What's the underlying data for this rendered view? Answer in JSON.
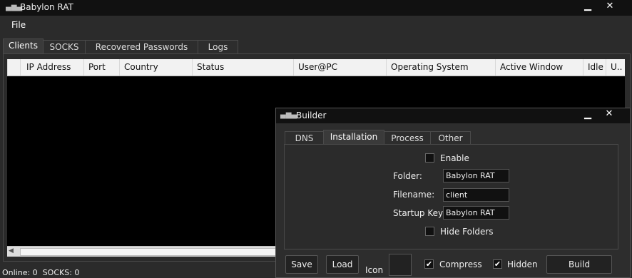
{
  "window": {
    "title": "Babylon RAT",
    "minimize_label": "▁",
    "close_label": "✕"
  },
  "menu": {
    "file_label": "File"
  },
  "tabs": [
    {
      "label": "Clients",
      "active": true
    },
    {
      "label": "SOCKS",
      "active": false
    },
    {
      "label": "Recovered Passwords",
      "active": false
    },
    {
      "label": "Logs",
      "active": false
    }
  ],
  "table": {
    "columns": [
      "IP Address",
      "Port",
      "Country",
      "Status",
      "User@PC",
      "Operating System",
      "Active Window",
      "Idle",
      "U.."
    ],
    "rows": []
  },
  "status": {
    "text": "Online: 0  SOCKS: 0"
  },
  "builder": {
    "title": "Builder",
    "minimize_label": "▁",
    "close_label": "✕",
    "tabs": [
      {
        "label": "DNS",
        "active": false
      },
      {
        "label": "Installation",
        "active": true
      },
      {
        "label": "Process",
        "active": false
      },
      {
        "label": "Other",
        "active": false
      }
    ],
    "installation": {
      "enable_label": "Enable",
      "enable_checked": false,
      "folder_label": "Folder:",
      "folder_value": "Babylon RAT",
      "filename_label": "Filename:",
      "filename_value": "client",
      "startup_key_label": "Startup Key:",
      "startup_key_value": "Babylon RAT",
      "hide_folders_label": "Hide Folders",
      "hide_folders_checked": false
    },
    "bottom": {
      "save_label": "Save",
      "load_label": "Load",
      "icon_label": "Icon",
      "compress_label": "Compress",
      "compress_checked": true,
      "hidden_label": "Hidden",
      "hidden_checked": true,
      "build_label": "Build",
      "check_glyph": "✔"
    }
  }
}
